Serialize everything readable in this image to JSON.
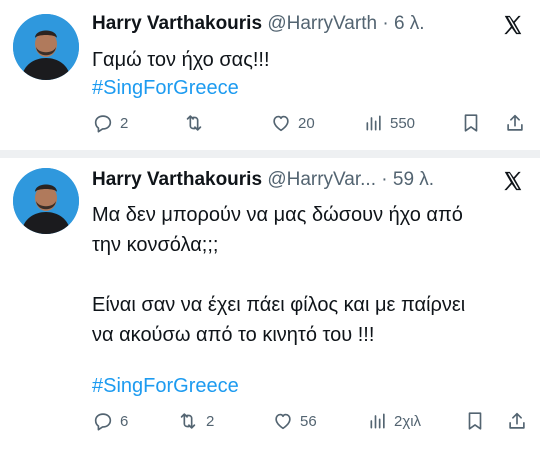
{
  "tweets": [
    {
      "name": "Harry Varthakouris",
      "handle": "@HarryVarth",
      "separator": "·",
      "time": "6 λ.",
      "text": "Γαμώ τον ήχο σας!!!",
      "hashtag": "#SingForGreece",
      "replies": "2",
      "retweets": "",
      "likes": "20",
      "views": "550"
    },
    {
      "name": "Harry Varthakouris",
      "handle": "@HarryVar...",
      "separator": "·",
      "time": "59 λ.",
      "text": "Μα δεν μπορούν να μας δώσουν ήχο από\nτην κονσόλα;;;\n\nΕίναι σαν να έχει πάει φίλος και με παίρνει\nνα ακούσω από το κινητό του !!!",
      "hashtag": "#SingForGreece",
      "replies": "6",
      "retweets": "2",
      "likes": "56",
      "views": "2χιλ"
    }
  ],
  "colors": {
    "text": "#0f1419",
    "muted": "#536471",
    "link": "#1d9bf0",
    "avatar_bg": "#2f98dd"
  },
  "icons": [
    "reply-icon",
    "retweet-icon",
    "like-icon",
    "views-icon",
    "bookmark-icon",
    "share-icon",
    "x-logo-icon"
  ]
}
